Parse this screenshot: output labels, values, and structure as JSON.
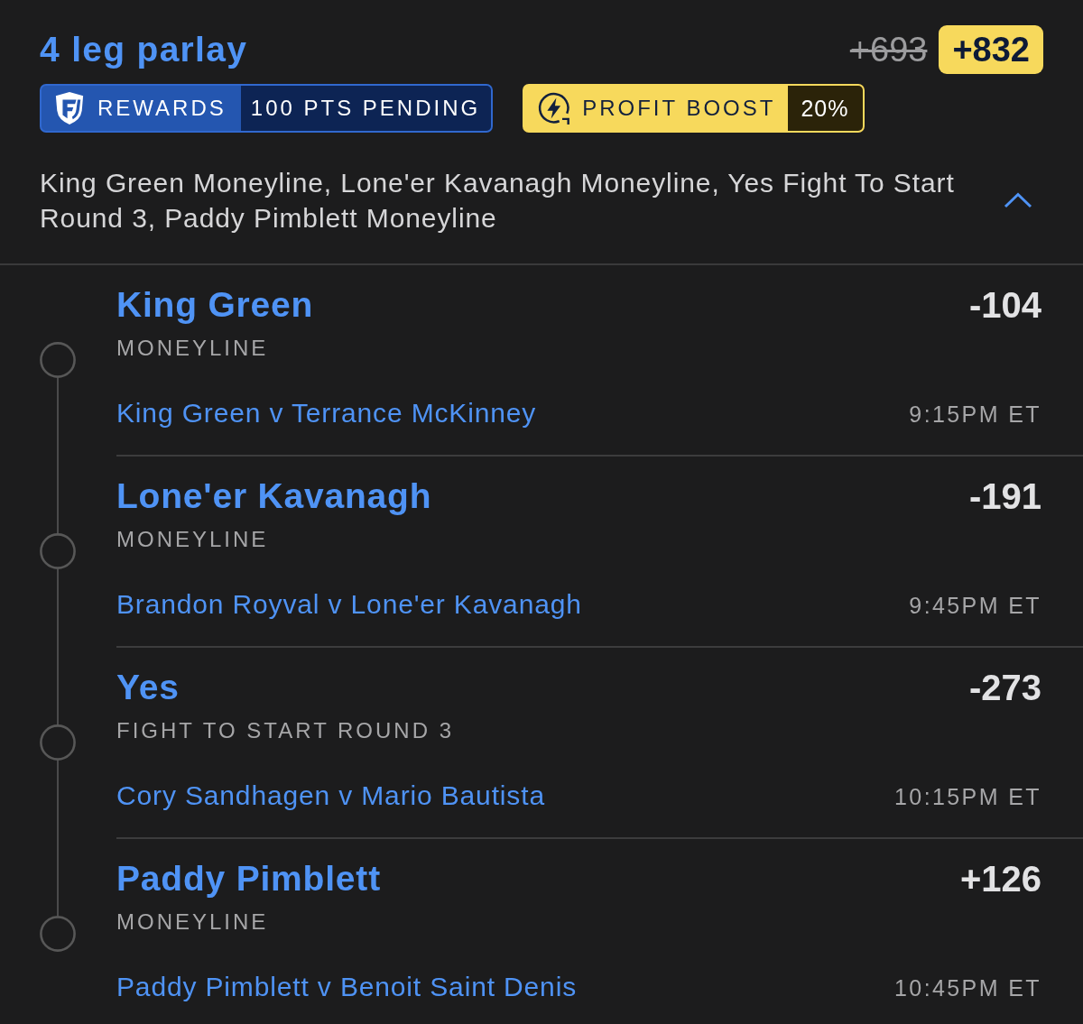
{
  "bet": {
    "title": "4 leg parlay",
    "original_odds": "+693",
    "boosted_odds": "+832"
  },
  "rewards": {
    "label": "REWARDS",
    "status": "100 PTS PENDING"
  },
  "profit_boost": {
    "label": "PROFIT BOOST",
    "percent": "20%"
  },
  "summary": "King Green Moneyline, Lone'er Kavanagh Moneyline, Yes Fight To Start Round 3, Paddy Pimblett Moneyline",
  "expanded": true,
  "legs": [
    {
      "selection": "King Green",
      "market": "MONEYLINE",
      "odds": "-104",
      "event": "King Green v Terrance McKinney",
      "time": "9:15PM ET"
    },
    {
      "selection": "Lone'er Kavanagh",
      "market": "MONEYLINE",
      "odds": "-191",
      "event": "Brandon Royval v Lone'er Kavanagh",
      "time": "9:45PM ET"
    },
    {
      "selection": "Yes",
      "market": "FIGHT TO START ROUND 3",
      "odds": "-273",
      "event": "Cory Sandhagen v Mario Bautista",
      "time": "10:15PM ET"
    },
    {
      "selection": "Paddy Pimblett",
      "market": "MONEYLINE",
      "odds": "+126",
      "event": "Paddy Pimblett v Benoit Saint Denis",
      "time": "10:45PM ET"
    }
  ]
}
